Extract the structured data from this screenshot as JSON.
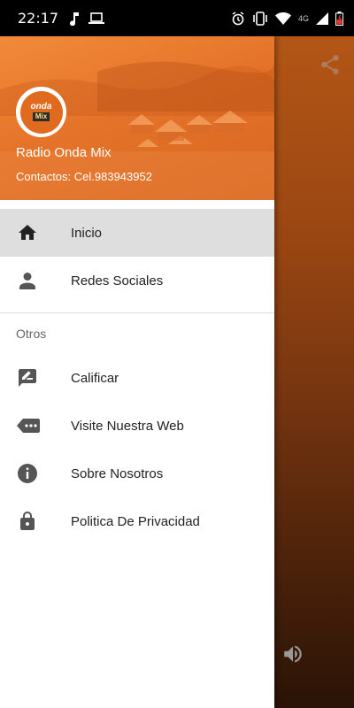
{
  "status_bar": {
    "time": "22:17",
    "icons_left": [
      "music-note-icon",
      "laptop-icon"
    ],
    "icons_right": [
      "alarm-icon",
      "vibrate-icon",
      "wifi-icon",
      "signal-icon",
      "battery-icon"
    ],
    "network_label": "4G"
  },
  "drawer": {
    "header": {
      "logo_text_top": "onda",
      "logo_text_bottom": "Mix",
      "station_name": "Radio Onda Mix",
      "contact": "Contactos: Cel.983943952",
      "background_color": "#e5742a"
    },
    "primary_items": [
      {
        "label": "Inicio",
        "icon": "home-icon",
        "active": true
      },
      {
        "label": "Redes Sociales",
        "icon": "person-icon",
        "active": false
      }
    ],
    "section_title": "Otros",
    "secondary_items": [
      {
        "label": "Calificar",
        "icon": "rate-review-icon"
      },
      {
        "label": "Visite Nuestra Web",
        "icon": "web-icon"
      },
      {
        "label": "Sobre Nosotros",
        "icon": "info-icon"
      },
      {
        "label": "Politica De Privacidad",
        "icon": "lock-icon"
      }
    ]
  },
  "background_app": {
    "share_icon": "share-icon",
    "volume_icon": "volume-icon"
  },
  "colors": {
    "accent": "#e5742a",
    "active_item_bg": "#dedede",
    "icon_color": "#555555"
  }
}
